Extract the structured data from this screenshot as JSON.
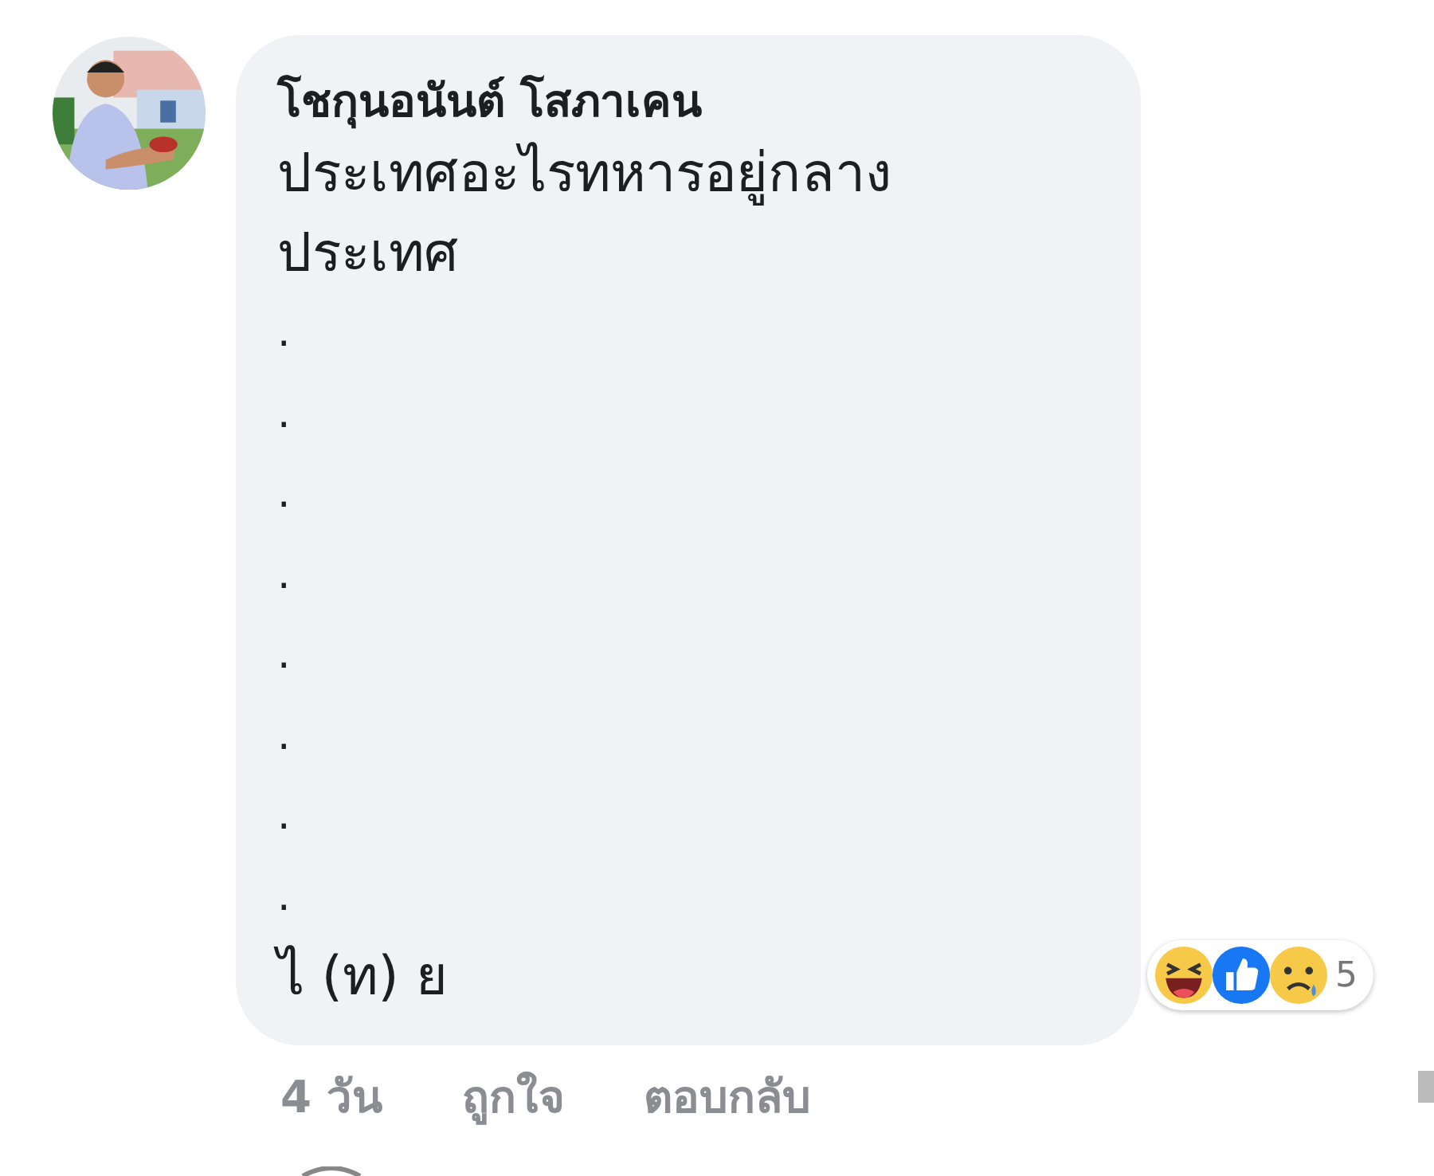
{
  "comment": {
    "author": "โชกุนอนันต์ โสภาเคน",
    "lines": [
      "ประเทศอะไรทหารอยู่กลาง",
      "ประเทศ",
      ".",
      ".",
      ".",
      ".",
      ".",
      ".",
      ".",
      ".",
      "ไ (ท) ย"
    ],
    "reactions": {
      "count": "5",
      "icons": [
        {
          "kind": "haha"
        },
        {
          "kind": "like"
        },
        {
          "kind": "sad"
        }
      ]
    },
    "actions": [
      "4 วัน",
      "ถูกใจ",
      "ตอบกลับ"
    ]
  }
}
